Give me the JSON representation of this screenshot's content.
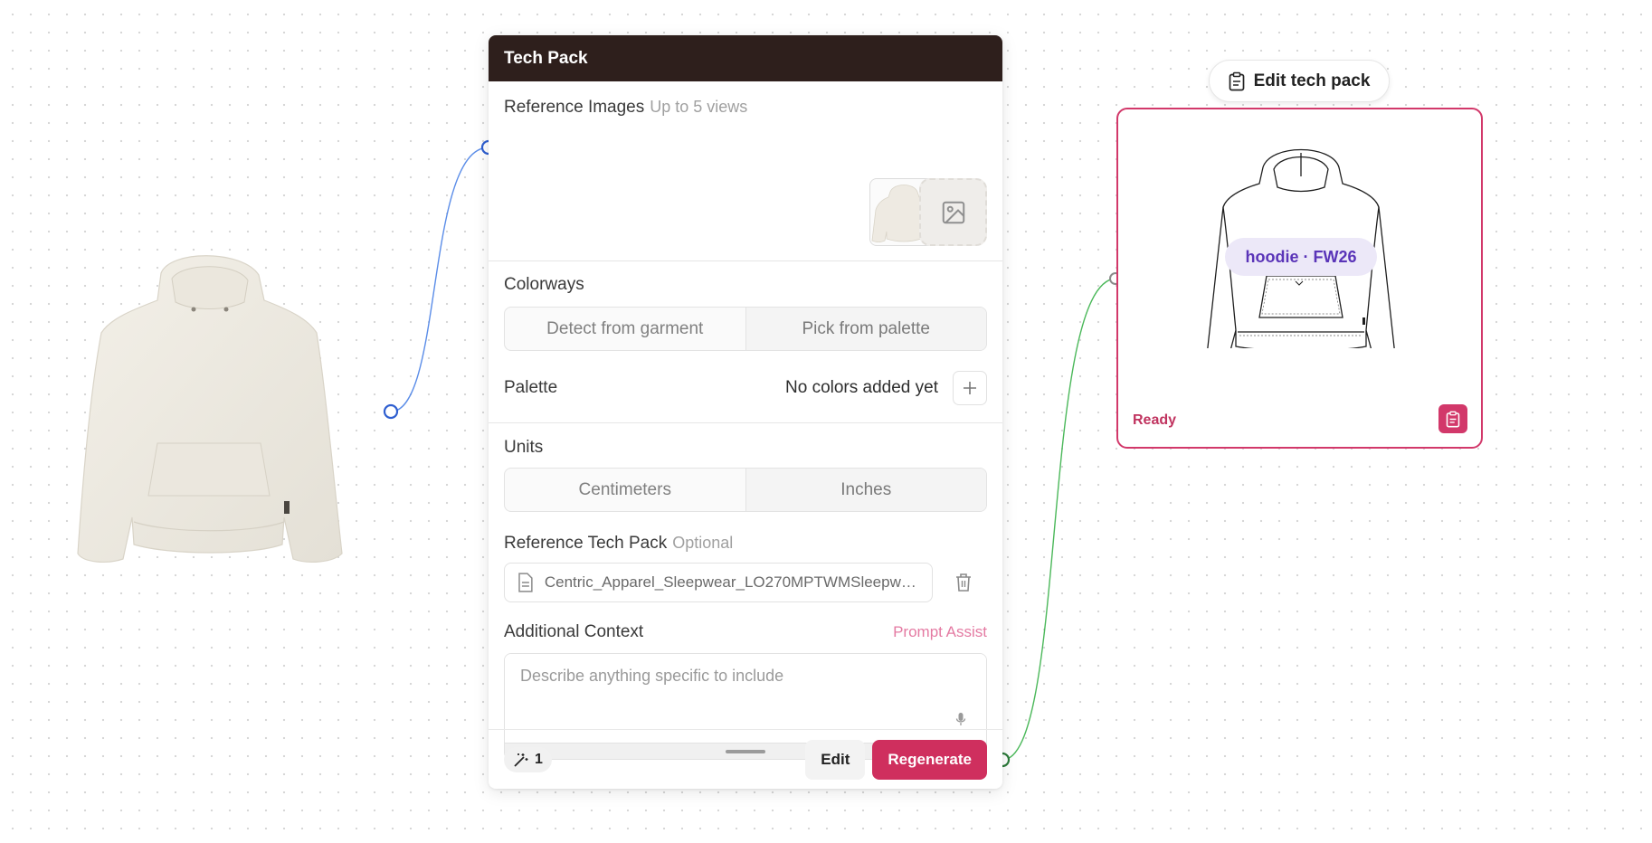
{
  "source_node": {
    "image": "cream-hoodie-photo"
  },
  "techpack": {
    "title": "Tech Pack",
    "reference_images": {
      "label": "Reference Images",
      "hint": "Up to 5 views"
    },
    "colorways": {
      "label": "Colorways",
      "options": [
        "Detect from garment",
        "Pick from palette"
      ]
    },
    "palette": {
      "label": "Palette",
      "empty_text": "No colors added yet",
      "add_icon": "plus-icon"
    },
    "units": {
      "label": "Units",
      "options": [
        "Centimeters",
        "Inches"
      ]
    },
    "reference_tech_pack": {
      "label": "Reference Tech Pack",
      "hint": "Optional",
      "file_name": "Centric_Apparel_Sleepwear_LO270MPTWMSleepwe..."
    },
    "additional_context": {
      "label": "Additional Context",
      "assist": "Prompt Assist",
      "placeholder": "Describe anything specific to include"
    },
    "footer": {
      "count": "1",
      "edit_label": "Edit",
      "regenerate_label": "Regenerate"
    }
  },
  "output_node": {
    "edit_button": "Edit tech pack",
    "badge": "hoodie · FW26",
    "status": "Ready"
  },
  "colors": {
    "header_bg": "#2e1f1c",
    "accent": "#cf2f5e",
    "edge_blue": "#5b8de8",
    "edge_green": "#4bb85a",
    "badge_text": "#5a34b8"
  }
}
